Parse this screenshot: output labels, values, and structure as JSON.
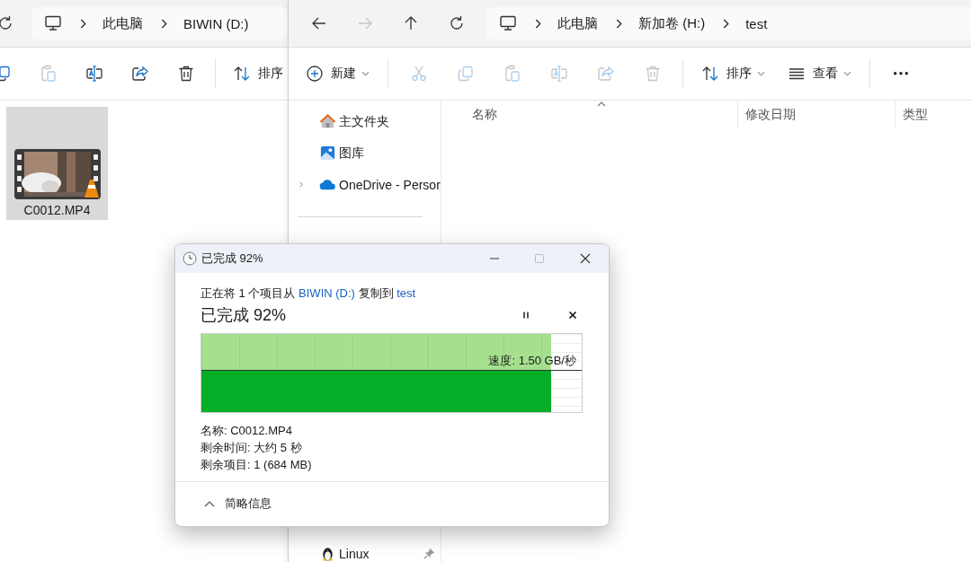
{
  "left_window": {
    "nav": [
      {
        "kind": "refresh",
        "disabled": false
      }
    ],
    "address": [
      "此电脑",
      "BIWIN (D:)"
    ],
    "toolbar": [
      {
        "kind": "copy",
        "disabled": false
      },
      {
        "kind": "paste",
        "disabled": true
      },
      {
        "kind": "rename",
        "disabled": false
      },
      {
        "kind": "share",
        "disabled": false
      },
      {
        "kind": "delete",
        "disabled": false
      },
      {
        "kind": "divider"
      },
      {
        "kind": "sort",
        "label": "排序",
        "dropdown": false
      }
    ],
    "files": [
      {
        "name": "C0012.MP4",
        "selected": true
      }
    ]
  },
  "right_window": {
    "nav": [
      {
        "kind": "back",
        "disabled": false
      },
      {
        "kind": "forward",
        "disabled": true
      },
      {
        "kind": "up",
        "disabled": false
      },
      {
        "kind": "refresh",
        "disabled": false
      }
    ],
    "address": [
      "此电脑",
      "新加卷 (H:)",
      "test"
    ],
    "toolbar": [
      {
        "kind": "new",
        "label": "新建",
        "dropdown": true
      },
      {
        "kind": "divider"
      },
      {
        "kind": "cut",
        "disabled": true
      },
      {
        "kind": "copy",
        "disabled": true
      },
      {
        "kind": "paste",
        "disabled": true
      },
      {
        "kind": "rename",
        "disabled": true
      },
      {
        "kind": "share",
        "disabled": true
      },
      {
        "kind": "delete",
        "disabled": true
      },
      {
        "kind": "divider"
      },
      {
        "kind": "sort",
        "label": "排序",
        "dropdown": true
      },
      {
        "kind": "view",
        "label": "查看",
        "dropdown": true
      },
      {
        "kind": "divider"
      },
      {
        "kind": "more"
      }
    ],
    "sidebar": {
      "items": [
        {
          "kind": "home",
          "label": "主文件夹",
          "expandable": false,
          "pinned": false
        },
        {
          "kind": "gallery",
          "label": "图库",
          "expandable": false,
          "pinned": false
        },
        {
          "kind": "cloud",
          "label": "OneDrive - Persor",
          "expandable": true,
          "pinned": false
        },
        {
          "kind": "divider"
        },
        {
          "kind": "linux",
          "label": "Linux",
          "expandable": false,
          "pinned": true
        }
      ]
    },
    "columns": [
      {
        "label": "名称",
        "sorted": true
      },
      {
        "label": "修改日期",
        "sorted": false
      },
      {
        "label": "类型",
        "sorted": false
      }
    ]
  },
  "copy_dialog": {
    "title": "已完成 92%",
    "message": {
      "before": "正在将 1 个项目从",
      "source": "BIWIN (D:)",
      "middle": "复制到",
      "destination": "test"
    },
    "heading": "已完成 92%",
    "level": 0.92,
    "speed": "速度: 1.50 GB/秒",
    "details": [
      "名称: C0012.MP4",
      "剩余时间: 大约 5 秒",
      "剩余项目: 1 (684 MB)"
    ],
    "toggle": "简略信息"
  }
}
